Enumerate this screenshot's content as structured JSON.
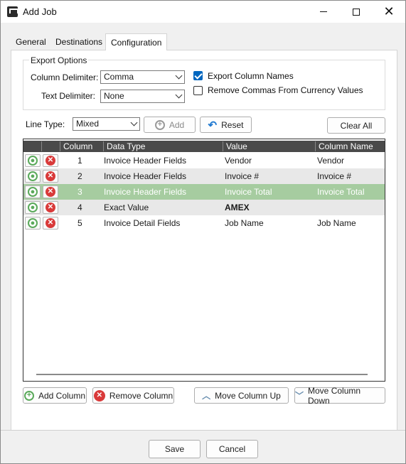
{
  "window": {
    "title": "Add Job"
  },
  "tabs": [
    {
      "label": "General"
    },
    {
      "label": "Destinations"
    },
    {
      "label": "Configuration"
    }
  ],
  "export_options": {
    "title": "Export Options",
    "column_delimiter_label": "Column Delimiter:",
    "column_delimiter_value": "Comma",
    "text_delimiter_label": "Text Delimiter:",
    "text_delimiter_value": "None",
    "export_column_names_label": "Export Column Names",
    "export_column_names_checked": true,
    "remove_commas_label": "Remove Commas From Currency Values",
    "remove_commas_checked": false
  },
  "line_type": {
    "label": "Line Type:",
    "value": "Mixed",
    "add_label": "Add",
    "reset_label": "Reset",
    "clear_all_label": "Clear All"
  },
  "grid": {
    "headers": [
      "Column",
      "Data Type",
      "Value",
      "Column Name"
    ],
    "rows": [
      {
        "column": "1",
        "data_type": "Invoice Header Fields",
        "value": "Vendor",
        "column_name": "Vendor"
      },
      {
        "column": "2",
        "data_type": "Invoice Header Fields",
        "value": "Invoice #",
        "column_name": "Invoice #"
      },
      {
        "column": "3",
        "data_type": "Invoice Header Fields",
        "value": "Invoice Total",
        "column_name": "Invoice Total"
      },
      {
        "column": "4",
        "data_type": "Exact Value",
        "value": "AMEX",
        "column_name": ""
      },
      {
        "column": "5",
        "data_type": "Invoice Detail Fields",
        "value": "Job Name",
        "column_name": "Job Name"
      }
    ],
    "selected_row": 3
  },
  "grid_actions": {
    "add_column": "Add Column",
    "remove_column": "Remove Column",
    "move_up": "Move Column Up",
    "move_down": "Move Column Down"
  },
  "footer": {
    "save": "Save",
    "cancel": "Cancel"
  },
  "colors": {
    "accent": "#0067c0",
    "selected_row": "#a6cca0",
    "grid_header": "#4a4a4a"
  }
}
